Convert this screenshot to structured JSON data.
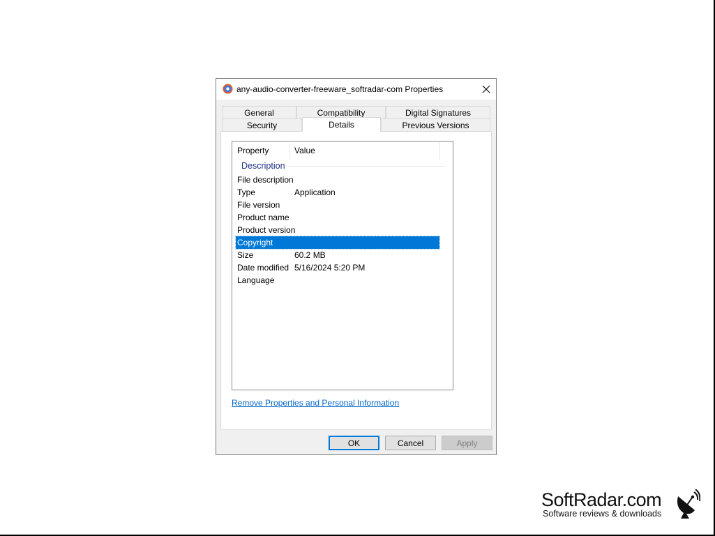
{
  "window": {
    "title": "any-audio-converter-freeware_softradar-com Properties",
    "close_glyph": "✕"
  },
  "tabs": {
    "row1": [
      "General",
      "Compatibility",
      "Digital Signatures"
    ],
    "row2": [
      "Security",
      "Details",
      "Previous Versions"
    ],
    "active": "Details"
  },
  "details": {
    "columns": [
      "Property",
      "Value"
    ],
    "group": "Description",
    "rows": [
      {
        "key": "File description",
        "value": ""
      },
      {
        "key": "Type",
        "value": "Application"
      },
      {
        "key": "File version",
        "value": ""
      },
      {
        "key": "Product name",
        "value": ""
      },
      {
        "key": "Product version",
        "value": ""
      },
      {
        "key": "Copyright",
        "value": "",
        "selected": true
      },
      {
        "key": "Size",
        "value": "60.2 MB"
      },
      {
        "key": "Date modified",
        "value": "5/16/2024 5:20 PM"
      },
      {
        "key": "Language",
        "value": ""
      }
    ],
    "remove_link": "Remove Properties and Personal Information"
  },
  "buttons": {
    "ok": "OK",
    "cancel": "Cancel",
    "apply": "Apply"
  },
  "watermark": {
    "name": "SoftRadar.com",
    "tagline": "Software reviews & downloads"
  },
  "colors": {
    "selection": "#0078d7",
    "link": "#0066cc",
    "group_header": "#1e3287"
  }
}
